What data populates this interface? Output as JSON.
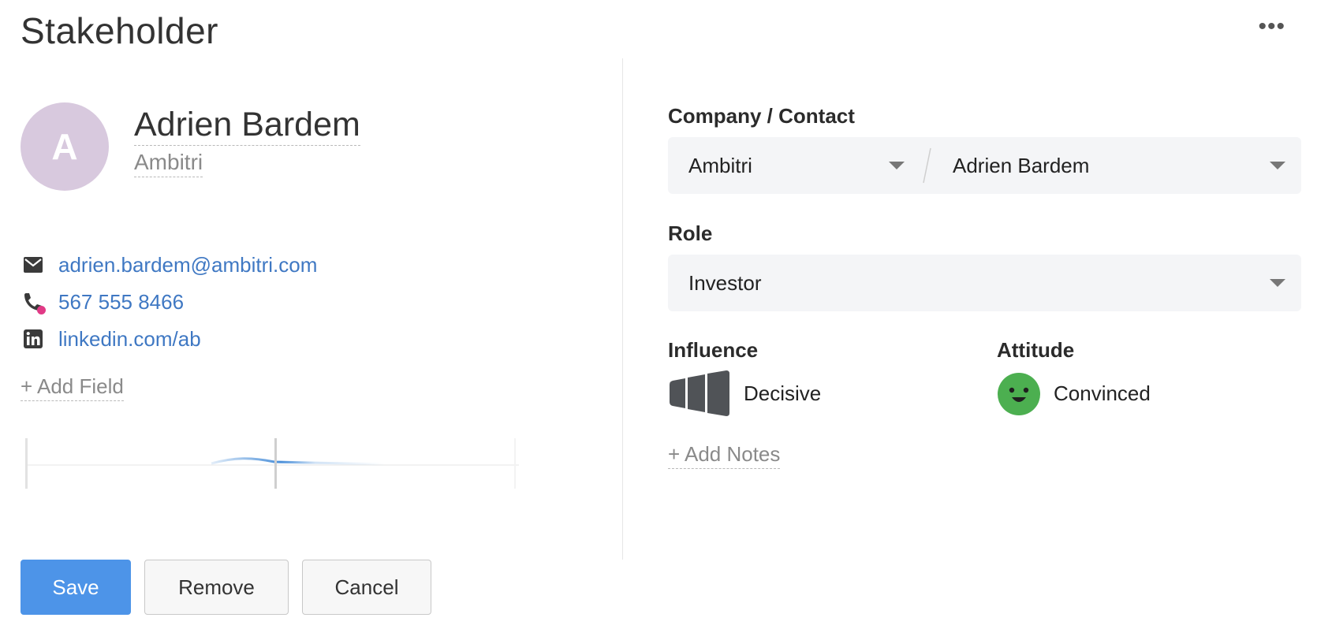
{
  "header": {
    "title": "Stakeholder",
    "more_icon": "more-horizontal-icon"
  },
  "profile": {
    "avatar_initial": "A",
    "avatar_color": "#d8c9de",
    "name": "Adrien Bardem",
    "company": "Ambitri"
  },
  "contacts": {
    "email": {
      "icon": "envelope-icon",
      "value": "adrien.bardem@ambitri.com"
    },
    "phone": {
      "icon": "phone-icon",
      "value": "567 555 8466",
      "status_color": "#e13a86"
    },
    "linkedin": {
      "icon": "linkedin-icon",
      "value": "linkedin.com/ab"
    }
  },
  "add_field_label": "+ Add Field",
  "actions": {
    "save": "Save",
    "remove": "Remove",
    "cancel": "Cancel"
  },
  "form": {
    "company_contact_label": "Company / Contact",
    "company_value": "Ambitri",
    "contact_value": "Adrien Bardem",
    "role_label": "Role",
    "role_value": "Investor",
    "influence_label": "Influence",
    "influence_value": "Decisive",
    "influence_icon": "influence-gauge-icon",
    "attitude_label": "Attitude",
    "attitude_value": "Convinced",
    "attitude_icon": "smiley-face-icon",
    "attitude_color": "#4caf50",
    "add_notes_label": "+ Add Notes"
  },
  "colors": {
    "primary": "#4d94e8",
    "link": "#3f78c3"
  }
}
